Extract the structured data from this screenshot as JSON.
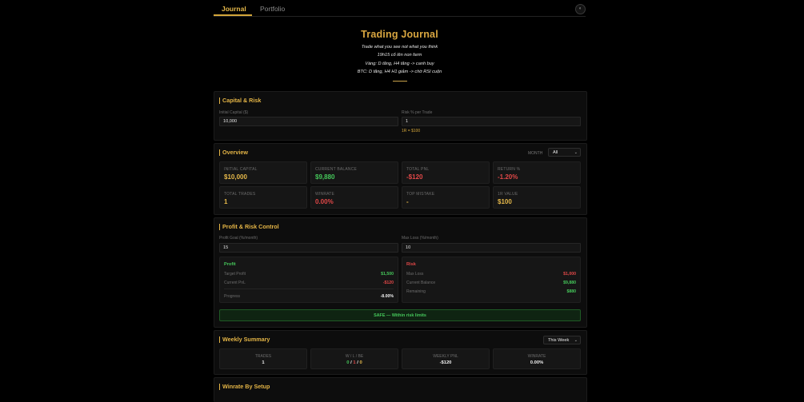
{
  "nav": {
    "tabs": [
      {
        "label": "Journal"
      },
      {
        "label": "Portfolio"
      }
    ],
    "theme_icon": "◐"
  },
  "hero": {
    "title": "Trading Journal",
    "lines": [
      "Trade what you see not what you think",
      "19h15 cố lên non farm",
      "Vàng: D tăng, H4 tăng -> canh buy",
      "BTC: D tăng, H4 H1 giảm -> chờ RSI cuộn"
    ]
  },
  "capital": {
    "title": "Capital & Risk",
    "initial_label": "Initial Capital ($)",
    "initial_value": "10,000",
    "risk_label": "Risk % per Trade",
    "risk_value": "1",
    "r_note": "1R = $100"
  },
  "overview": {
    "title": "Overview",
    "month_label": "MONTH",
    "month_value": "All",
    "stats": [
      {
        "label": "INITIAL CAPITAL",
        "value": "$10,000"
      },
      {
        "label": "CURRENT BALANCE",
        "value": "$9,880"
      },
      {
        "label": "TOTAL PNL",
        "value": "-$120"
      },
      {
        "label": "RETURN %",
        "value": "-1.20%"
      },
      {
        "label": "TOTAL TRADES",
        "value": "1"
      },
      {
        "label": "WINRATE",
        "value": "0.00%"
      },
      {
        "label": "TOP MISTAKE",
        "value": "-"
      },
      {
        "label": "1R VALUE",
        "value": "$100"
      }
    ],
    "colors": {
      "gold": "#e6b94a",
      "green": "#45c65a",
      "red": "#e24848"
    }
  },
  "profit_risk": {
    "title": "Profit & Risk Control",
    "goal_label": "Profit Goal (%/month)",
    "goal_value": "15",
    "maxloss_label": "Max Loss (%/month)",
    "maxloss_value": "10",
    "profit": {
      "heading": "Profit",
      "rows": [
        {
          "label": "Target Profit",
          "value": "$1,500"
        },
        {
          "label": "Current PnL",
          "value": "-$120"
        }
      ],
      "progress_label": "Progress",
      "progress_value": "-8.00%"
    },
    "risk": {
      "heading": "Risk",
      "rows": [
        {
          "label": "Max Loss",
          "value": "$1,000"
        },
        {
          "label": "Current Balance",
          "value": "$9,880"
        },
        {
          "label": "Remaining",
          "value": "$880"
        }
      ]
    },
    "status": "SAFE — Within risk limits"
  },
  "weekly": {
    "title": "Weekly Summary",
    "period": "This Week",
    "stats": [
      {
        "label": "TRADES",
        "value": "1"
      },
      {
        "label": "W / L / BE",
        "w": "0",
        "l": "1",
        "be": "0"
      },
      {
        "label": "WEEKLY PNL",
        "value": "-$120"
      },
      {
        "label": "WINRATE",
        "value": "0.00%"
      }
    ]
  },
  "setup": {
    "title": "Winrate By Setup"
  }
}
